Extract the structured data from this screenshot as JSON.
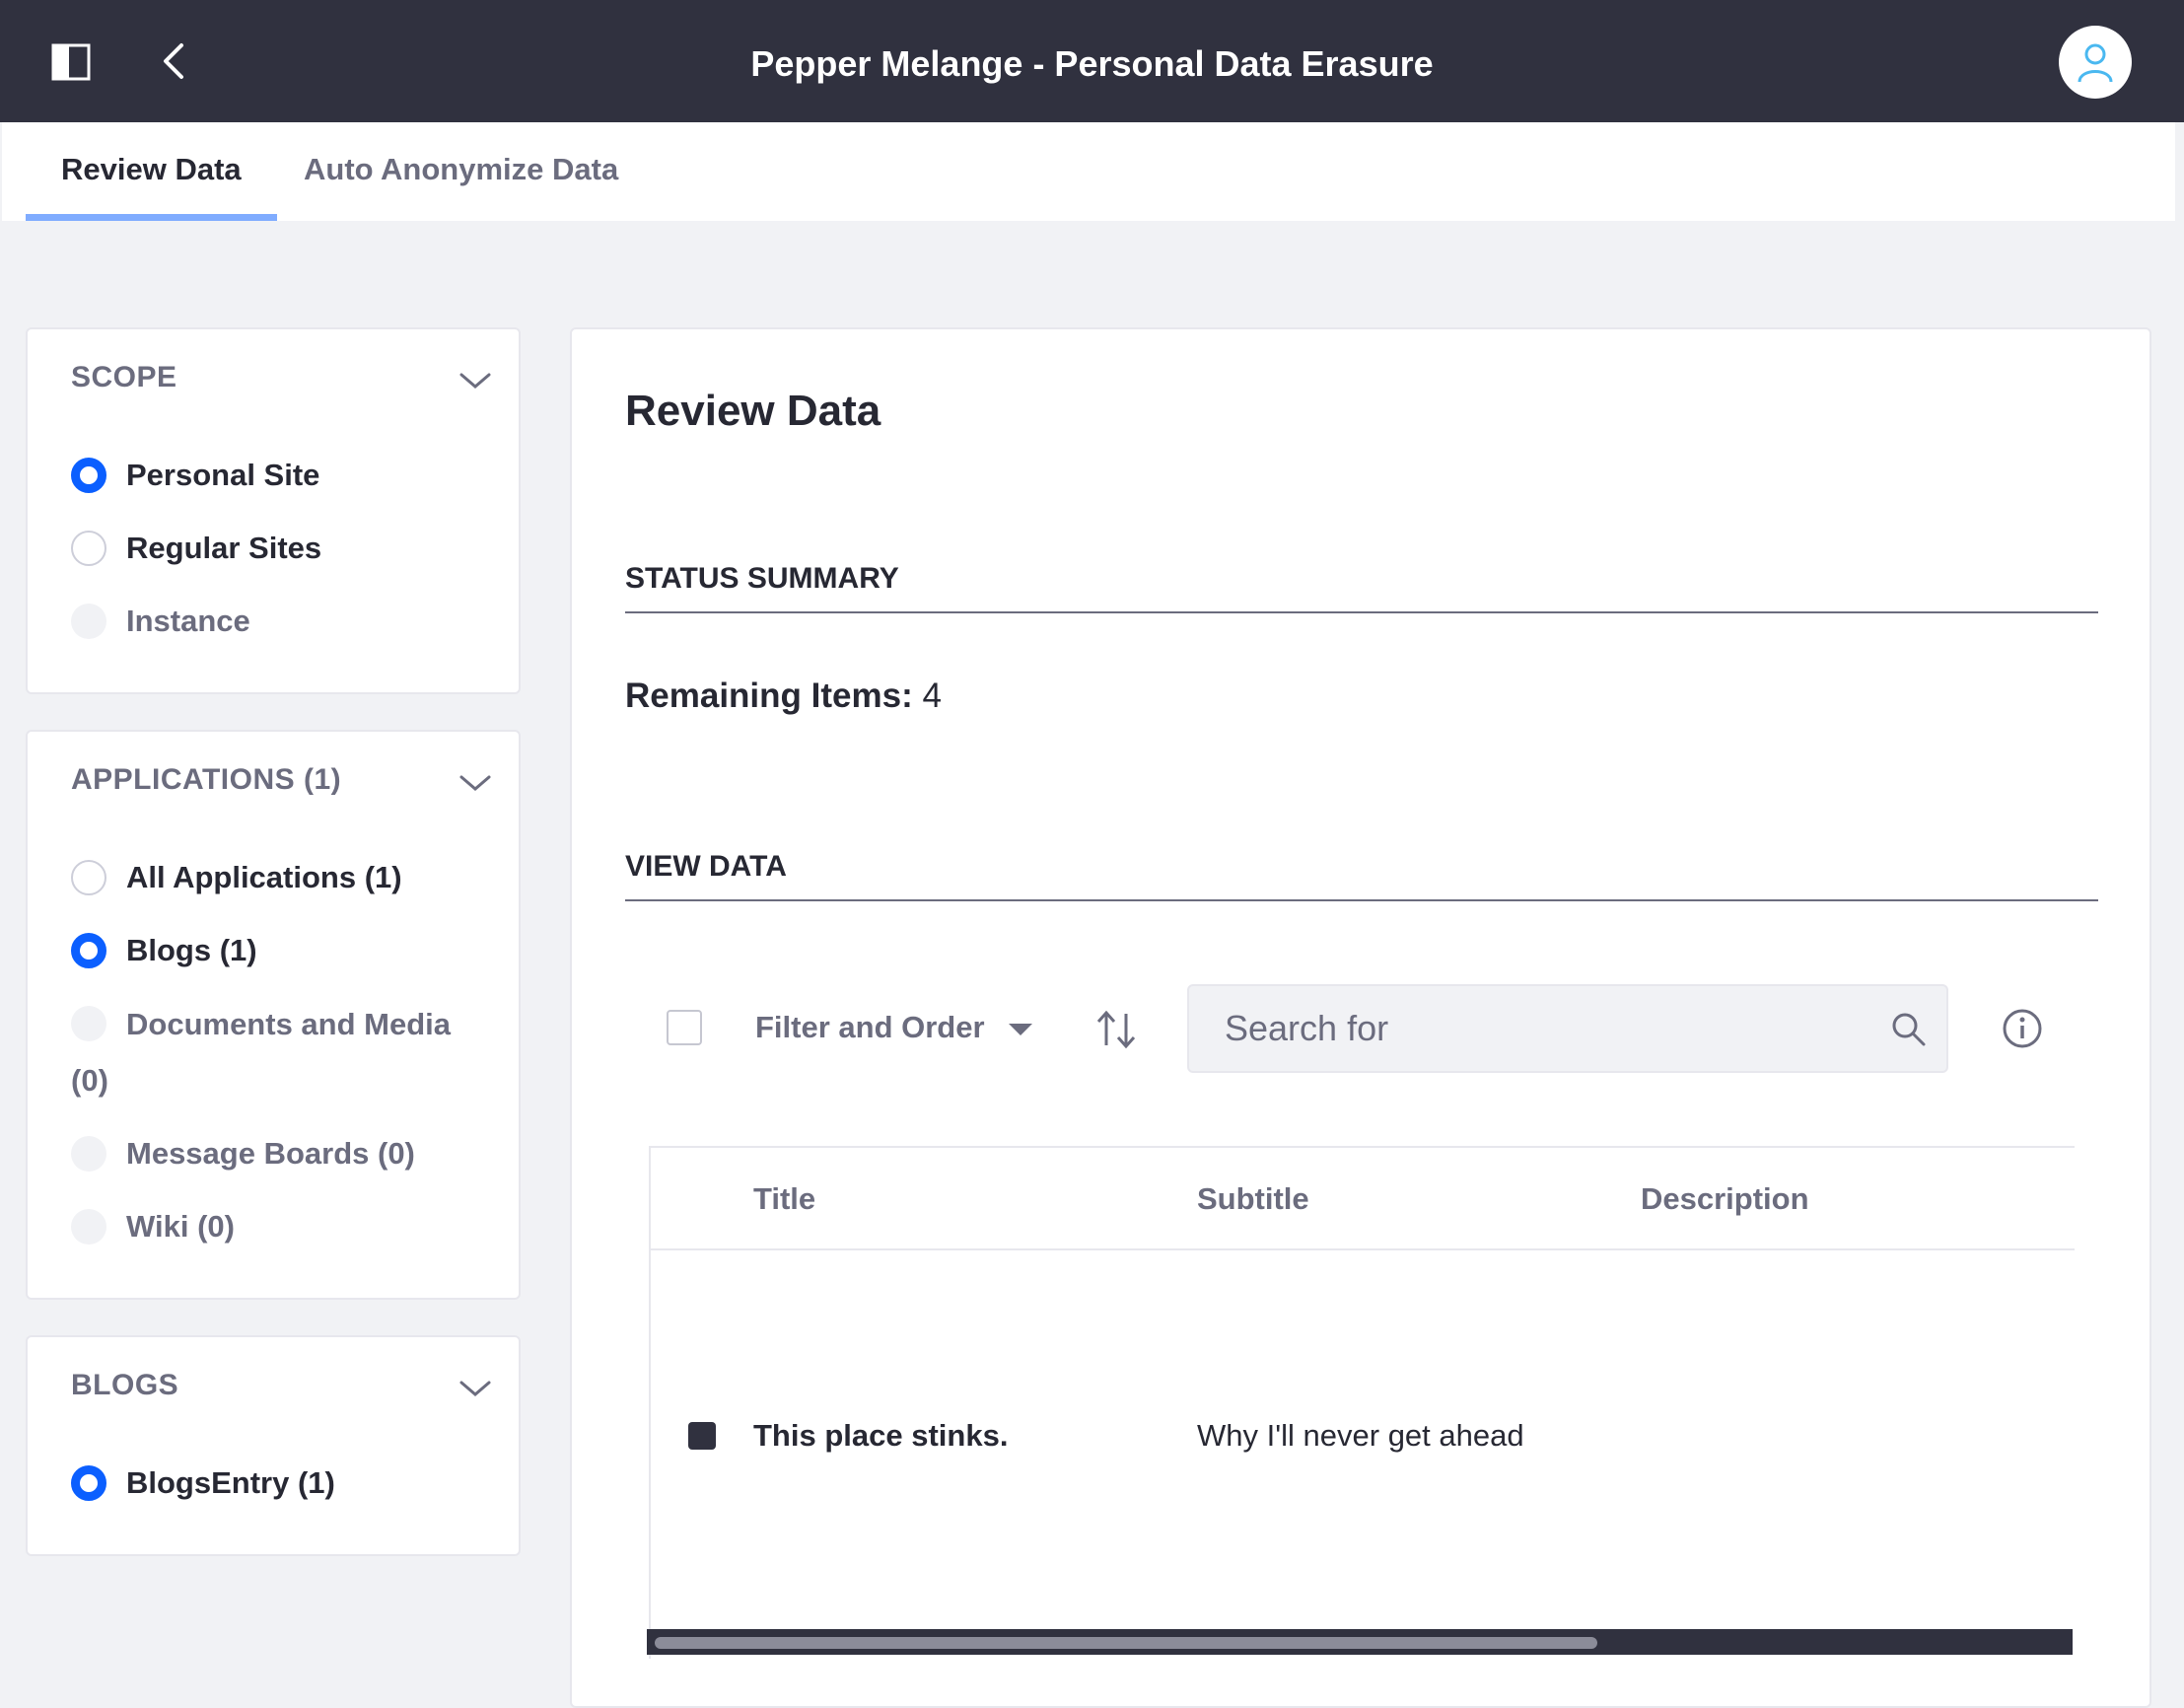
{
  "header": {
    "title": "Pepper Melange - Personal Data Erasure",
    "sidebar_toggle_icon": "sidebar-toggle-icon",
    "back_icon": "chevron-left-icon",
    "avatar_icon": "user-icon"
  },
  "tabs": [
    {
      "label": "Review Data",
      "active": true
    },
    {
      "label": "Auto Anonymize Data",
      "active": false
    }
  ],
  "scope": {
    "heading": "SCOPE",
    "options": [
      {
        "label": "Personal Site",
        "state": "checked"
      },
      {
        "label": "Regular Sites",
        "state": "unchecked"
      },
      {
        "label": "Instance",
        "state": "disabled"
      }
    ]
  },
  "applications": {
    "heading": "APPLICATIONS (1)",
    "options": [
      {
        "label": "All Applications (1)",
        "state": "unchecked"
      },
      {
        "label": "Blogs (1)",
        "state": "checked"
      },
      {
        "label": "Documents and Media (0)",
        "state": "disabled"
      },
      {
        "label": "Message Boards (0)",
        "state": "disabled"
      },
      {
        "label": "Wiki (0)",
        "state": "disabled"
      }
    ]
  },
  "blogs": {
    "heading": "BLOGS",
    "options": [
      {
        "label": "BlogsEntry (1)",
        "state": "checked"
      }
    ]
  },
  "main": {
    "title": "Review Data",
    "status_heading": "STATUS SUMMARY",
    "remaining_label": "Remaining Items:",
    "remaining_value": "4",
    "view_heading": "VIEW DATA",
    "filter_label": "Filter and Order",
    "search_placeholder": "Search for",
    "columns": [
      "Title",
      "Subtitle",
      "Description"
    ],
    "rows": [
      {
        "title": "This place stinks.",
        "subtitle": "Why I'll never get ahead",
        "description": ""
      }
    ]
  },
  "colors": {
    "header_bg": "#30313f",
    "accent": "#0b5fff",
    "tab_indicator": "#80acff",
    "page_bg": "#f1f2f5"
  }
}
